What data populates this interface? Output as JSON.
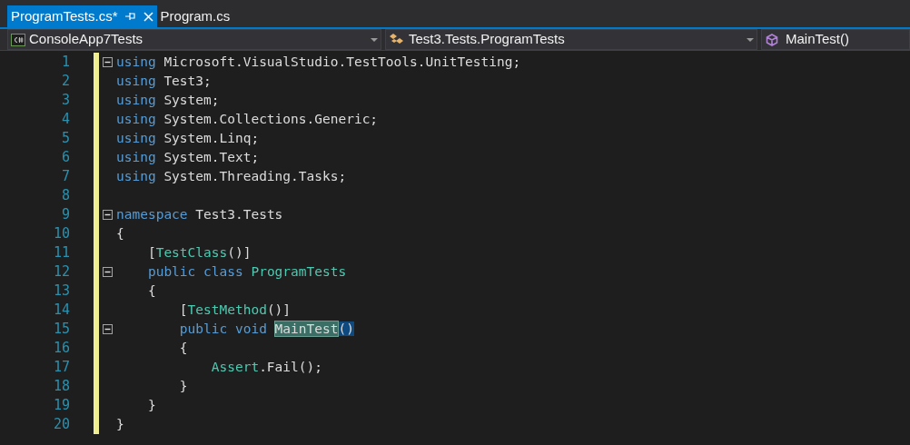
{
  "tabs": [
    {
      "label": "ProgramTests.cs*",
      "selected": true
    },
    {
      "label": "Program.cs",
      "selected": false
    }
  ],
  "navigation_bar": {
    "project": "ConsoleApp7Tests",
    "type": "Test3.Tests.ProgramTests",
    "member": "MainTest()"
  },
  "editor": {
    "lines": [
      {
        "number": "1",
        "modified": true,
        "collapsible": true,
        "tokens": [
          {
            "kind": "keyword",
            "text": "using"
          },
          {
            "kind": "plain",
            "text": " Microsoft.VisualStudio.TestTools.UnitTesting;"
          }
        ]
      },
      {
        "number": "2",
        "modified": true,
        "collapsible": false,
        "tokens": [
          {
            "kind": "keyword",
            "text": "using"
          },
          {
            "kind": "plain",
            "text": " Test3;"
          }
        ]
      },
      {
        "number": "3",
        "modified": true,
        "collapsible": false,
        "tokens": [
          {
            "kind": "keyword",
            "text": "using"
          },
          {
            "kind": "plain",
            "text": " System;"
          }
        ]
      },
      {
        "number": "4",
        "modified": true,
        "collapsible": false,
        "tokens": [
          {
            "kind": "keyword",
            "text": "using"
          },
          {
            "kind": "plain",
            "text": " System.Collections.Generic;"
          }
        ]
      },
      {
        "number": "5",
        "modified": true,
        "collapsible": false,
        "tokens": [
          {
            "kind": "keyword",
            "text": "using"
          },
          {
            "kind": "plain",
            "text": " System.Linq;"
          }
        ]
      },
      {
        "number": "6",
        "modified": true,
        "collapsible": false,
        "tokens": [
          {
            "kind": "keyword",
            "text": "using"
          },
          {
            "kind": "plain",
            "text": " System.Text;"
          }
        ]
      },
      {
        "number": "7",
        "modified": true,
        "collapsible": false,
        "tokens": [
          {
            "kind": "keyword",
            "text": "using"
          },
          {
            "kind": "plain",
            "text": " System.Threading.Tasks;"
          }
        ]
      },
      {
        "number": "8",
        "modified": true,
        "collapsible": false
      },
      {
        "number": "9",
        "modified": true,
        "collapsible": true,
        "tokens": [
          {
            "kind": "keyword",
            "text": "namespace"
          },
          {
            "kind": "plain",
            "text": " Test3.Tests"
          }
        ]
      },
      {
        "number": "10",
        "modified": true,
        "collapsible": false,
        "tokens": [
          {
            "kind": "plain",
            "text": "{"
          }
        ]
      },
      {
        "number": "11",
        "modified": true,
        "collapsible": false,
        "tokens": [
          {
            "kind": "plain",
            "text": "    ["
          },
          {
            "kind": "type",
            "text": "TestClass"
          },
          {
            "kind": "plain",
            "text": "()]"
          }
        ]
      },
      {
        "number": "12",
        "modified": true,
        "collapsible": true,
        "tokens": [
          {
            "kind": "keyword",
            "text": "    public class"
          },
          {
            "kind": "type",
            "text": " ProgramTests"
          }
        ]
      },
      {
        "number": "13",
        "modified": true,
        "collapsible": false,
        "tokens": [
          {
            "kind": "plain",
            "text": "    {"
          }
        ]
      },
      {
        "number": "14",
        "modified": true,
        "collapsible": false,
        "tokens": [
          {
            "kind": "plain",
            "text": "        ["
          },
          {
            "kind": "type",
            "text": "TestMethod"
          },
          {
            "kind": "plain",
            "text": "()]"
          }
        ]
      },
      {
        "number": "15",
        "modified": true,
        "collapsible": true,
        "tokens": [
          {
            "kind": "keyword",
            "text": "        public void "
          },
          {
            "kind": "highlight",
            "text": "MainTest"
          },
          {
            "kind": "match",
            "text": "()"
          }
        ]
      },
      {
        "number": "16",
        "modified": true,
        "collapsible": false,
        "tokens": [
          {
            "kind": "plain",
            "text": "        {"
          }
        ]
      },
      {
        "number": "17",
        "modified": true,
        "collapsible": false,
        "tokens": [
          {
            "kind": "type",
            "text": "            Assert"
          },
          {
            "kind": "plain",
            "text": ".Fail();"
          }
        ]
      },
      {
        "number": "18",
        "modified": true,
        "collapsible": false,
        "tokens": [
          {
            "kind": "plain",
            "text": "        }"
          }
        ]
      },
      {
        "number": "19",
        "modified": true,
        "collapsible": false,
        "tokens": [
          {
            "kind": "plain",
            "text": "    }"
          }
        ]
      },
      {
        "number": "20",
        "modified": true,
        "collapsible": false,
        "tokens": [
          {
            "kind": "plain",
            "text": "}"
          }
        ]
      }
    ]
  }
}
